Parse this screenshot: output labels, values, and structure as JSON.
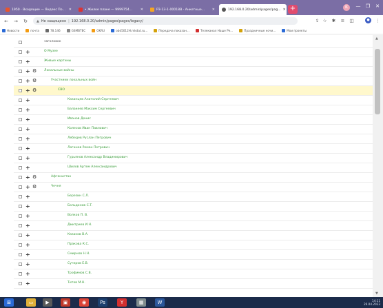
{
  "browser": {
    "tabs": [
      {
        "title": "1950 · Входящие — Яндекс По...",
        "favicon_color": "#e8542c"
      },
      {
        "title": "• Жилое плане — 9999754...",
        "favicon_color": "#d33"
      },
      {
        "title": "РЗ-13-1-00018В - Анкетные...",
        "favicon_color": "#f6a623"
      },
      {
        "title": "192.168.0.20/admin/pages/pag...",
        "favicon_color": "#555",
        "active": true
      }
    ],
    "new_tab_label": "+",
    "profile_initial": "K",
    "window_minimize": "—",
    "window_maximize": "❐",
    "window_close": "✕"
  },
  "address_bar": {
    "lock_text": "Не защищено",
    "url": "192.168.0.20/admin/pages/pages/legacy/"
  },
  "bookmarks": [
    {
      "label": "Новости",
      "color": "#2a6ad6"
    },
    {
      "label": "почта",
      "color": "#f39c12"
    },
    {
      "label": "78.146",
      "color": "#6a6a6a"
    },
    {
      "label": "GSMBTEC",
      "color": "#888"
    },
    {
      "label": "OKRU",
      "color": "#f39c12"
    },
    {
      "label": "obd5012H.mkdat.ru...",
      "color": "#2a6ad6"
    },
    {
      "label": "Передача показан...",
      "color": "#d4a20a"
    },
    {
      "label": "Телеканал Наше Ре...",
      "color": "#d32f2f"
    },
    {
      "label": "Праздничные ночи...",
      "color": "#d4a20a"
    },
    {
      "label": "Мои проекты",
      "color": "#2a6ad6"
    }
  ],
  "table": {
    "header_label": "заголовок",
    "rows": [
      {
        "label": "О Музее",
        "plus": true,
        "gear": false,
        "indent": 0,
        "highlight": false
      },
      {
        "label": "Живые картины",
        "plus": true,
        "gear": false,
        "indent": 0,
        "highlight": false
      },
      {
        "label": "Локальные войны",
        "plus": true,
        "gear": true,
        "indent": 0,
        "highlight": false
      },
      {
        "label": "Участники локальных войн",
        "plus": true,
        "gear": true,
        "indent": 1,
        "highlight": false
      },
      {
        "label": "СВО",
        "plus": true,
        "gear": true,
        "indent": 2,
        "highlight": true
      },
      {
        "label": "Казанцев Анатолий Сергеевич",
        "plus": true,
        "gear": false,
        "indent": 3,
        "highlight": false
      },
      {
        "label": "Балакеев Максим Сергеевич",
        "plus": true,
        "gear": false,
        "indent": 3,
        "highlight": false
      },
      {
        "label": "Иванов Денис",
        "plus": true,
        "gear": false,
        "indent": 3,
        "highlight": false
      },
      {
        "label": "Колесов Иван Павлович",
        "plus": true,
        "gear": false,
        "indent": 3,
        "highlight": false
      },
      {
        "label": "Лебедев Руслан Петрович",
        "plus": true,
        "gear": false,
        "indent": 3,
        "highlight": false
      },
      {
        "label": "Логинов Роман Петрович",
        "plus": true,
        "gear": false,
        "indent": 3,
        "highlight": false
      },
      {
        "label": "Гурьянов Александр Владимирович",
        "plus": true,
        "gear": false,
        "indent": 3,
        "highlight": false
      },
      {
        "label": "Шилов Артем Александрович",
        "plus": true,
        "gear": false,
        "indent": 3,
        "highlight": false
      },
      {
        "label": "Афганистан",
        "plus": true,
        "gear": true,
        "indent": 1,
        "highlight": false
      },
      {
        "label": "Чечня",
        "plus": true,
        "gear": true,
        "indent": 1,
        "highlight": false
      },
      {
        "label": "Березин С.Л.",
        "plus": true,
        "gear": false,
        "indent": 3,
        "highlight": false
      },
      {
        "label": "Больдонов С.Т.",
        "plus": true,
        "gear": false,
        "indent": 3,
        "highlight": false
      },
      {
        "label": "Волков П. В.",
        "plus": true,
        "gear": false,
        "indent": 3,
        "highlight": false
      },
      {
        "label": "Дмитриев И.Н.",
        "plus": true,
        "gear": false,
        "indent": 3,
        "highlight": false
      },
      {
        "label": "Казаков В.А.",
        "plus": true,
        "gear": false,
        "indent": 3,
        "highlight": false
      },
      {
        "label": "Пракова К.С.",
        "plus": true,
        "gear": false,
        "indent": 3,
        "highlight": false
      },
      {
        "label": "Смирнов Н.Н.",
        "plus": true,
        "gear": false,
        "indent": 3,
        "highlight": false
      },
      {
        "label": "Сучкров Е.В.",
        "plus": true,
        "gear": false,
        "indent": 3,
        "highlight": false
      },
      {
        "label": "Трофимов С.В.",
        "plus": true,
        "gear": false,
        "indent": 3,
        "highlight": false
      },
      {
        "label": "Титов М.Н.",
        "plus": true,
        "gear": false,
        "indent": 3,
        "highlight": false
      }
    ]
  },
  "taskbar": {
    "time": "14:11",
    "date": "26.04.2023",
    "apps": [
      {
        "icon": "windows-icon",
        "glyph": "⊞",
        "color": "#2a6ad6"
      },
      {
        "icon": "folder-icon",
        "glyph": "▭",
        "color": "#e0b03a"
      },
      {
        "icon": "media-icon",
        "glyph": "▶",
        "color": "#5a5a5a"
      },
      {
        "icon": "archive-icon",
        "glyph": "▣",
        "color": "#c0392b"
      },
      {
        "icon": "chrome-icon",
        "glyph": "◉",
        "color": "#db4437"
      },
      {
        "icon": "photoshop-icon",
        "glyph": "Ps",
        "color": "#1c3f6e"
      },
      {
        "icon": "yandex-icon",
        "glyph": "Y",
        "color": "#d32f2f"
      },
      {
        "icon": "calculator-icon",
        "glyph": "▦",
        "color": "#7f8c8d"
      },
      {
        "icon": "word-icon",
        "glyph": "W",
        "color": "#2b579a"
      }
    ]
  }
}
